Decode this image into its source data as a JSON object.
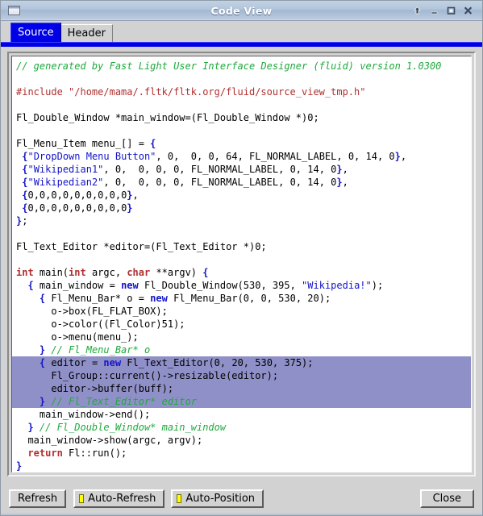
{
  "window": {
    "title": "Code View",
    "icon": "window-icon",
    "controls": [
      {
        "name": "shade-icon",
        "glyph": "up-arrow"
      },
      {
        "name": "minimize-icon",
        "glyph": "minimize"
      },
      {
        "name": "maximize-icon",
        "glyph": "maximize"
      },
      {
        "name": "close-icon",
        "glyph": "close"
      }
    ]
  },
  "tabs": [
    {
      "label": "Source",
      "active": true
    },
    {
      "label": "Header",
      "active": false
    }
  ],
  "code": {
    "caret": "`",
    "lines": [
      {
        "selected": false,
        "tokens": [
          {
            "t": "// generated by Fast Light User Interface Designer (fluid) version 1.0300",
            "c": "c-cmt"
          }
        ]
      },
      {
        "selected": false,
        "tokens": []
      },
      {
        "selected": false,
        "tokens": [
          {
            "t": "#include \"/home/mama/.fltk/fltk.org/fluid/source_view_tmp.h\"",
            "c": "c-pre"
          }
        ]
      },
      {
        "selected": false,
        "tokens": []
      },
      {
        "selected": false,
        "tokens": [
          {
            "t": "Fl_Double_Window *main_window=(Fl_Double_Window *)0;",
            "c": "c-pln"
          }
        ]
      },
      {
        "selected": false,
        "tokens": []
      },
      {
        "selected": false,
        "tokens": [
          {
            "t": "Fl_Menu_Item menu_[] = ",
            "c": "c-pln"
          },
          {
            "t": "{",
            "c": "c-blu"
          }
        ]
      },
      {
        "selected": false,
        "tokens": [
          {
            "t": " ",
            "c": "c-pln"
          },
          {
            "t": "{",
            "c": "c-blu"
          },
          {
            "t": "\"DropDown Menu Button\"",
            "c": "c-str"
          },
          {
            "t": ", 0,  0, 0, 64, FL_NORMAL_LABEL, 0, 14, 0",
            "c": "c-pln"
          },
          {
            "t": "}",
            "c": "c-blu"
          },
          {
            "t": ",",
            "c": "c-pln"
          }
        ]
      },
      {
        "selected": false,
        "tokens": [
          {
            "t": " ",
            "c": "c-pln"
          },
          {
            "t": "{",
            "c": "c-blu"
          },
          {
            "t": "\"Wikipedian1\"",
            "c": "c-str"
          },
          {
            "t": ", 0,  0, 0, 0, FL_NORMAL_LABEL, 0, 14, 0",
            "c": "c-pln"
          },
          {
            "t": "}",
            "c": "c-blu"
          },
          {
            "t": ",",
            "c": "c-pln"
          }
        ]
      },
      {
        "selected": false,
        "tokens": [
          {
            "t": " ",
            "c": "c-pln"
          },
          {
            "t": "{",
            "c": "c-blu"
          },
          {
            "t": "\"Wikipedian2\"",
            "c": "c-str"
          },
          {
            "t": ", 0,  0, 0, 0, FL_NORMAL_LABEL, 0, 14, 0",
            "c": "c-pln"
          },
          {
            "t": "}",
            "c": "c-blu"
          },
          {
            "t": ",",
            "c": "c-pln"
          }
        ]
      },
      {
        "selected": false,
        "tokens": [
          {
            "t": " ",
            "c": "c-pln"
          },
          {
            "t": "{",
            "c": "c-blu"
          },
          {
            "t": "0,0,0,0,0,0,0,0,0",
            "c": "c-pln"
          },
          {
            "t": "}",
            "c": "c-blu"
          },
          {
            "t": ",",
            "c": "c-pln"
          }
        ]
      },
      {
        "selected": false,
        "tokens": [
          {
            "t": " ",
            "c": "c-pln"
          },
          {
            "t": "{",
            "c": "c-blu"
          },
          {
            "t": "0,0,0,0,0,0,0,0,0",
            "c": "c-pln"
          },
          {
            "t": "}",
            "c": "c-blu"
          }
        ]
      },
      {
        "selected": false,
        "tokens": [
          {
            "t": "}",
            "c": "c-blu"
          },
          {
            "t": ";",
            "c": "c-pln"
          }
        ]
      },
      {
        "selected": false,
        "tokens": []
      },
      {
        "selected": false,
        "tokens": [
          {
            "t": "Fl_Text_Editor *editor=(Fl_Text_Editor *)0;",
            "c": "c-pln"
          }
        ]
      },
      {
        "selected": false,
        "tokens": []
      },
      {
        "selected": false,
        "tokens": [
          {
            "t": "int",
            "c": "c-kw"
          },
          {
            "t": " main(",
            "c": "c-pln"
          },
          {
            "t": "int",
            "c": "c-kw"
          },
          {
            "t": " argc, ",
            "c": "c-pln"
          },
          {
            "t": "char",
            "c": "c-kw"
          },
          {
            "t": " **argv) ",
            "c": "c-pln"
          },
          {
            "t": "{",
            "c": "c-blu"
          }
        ]
      },
      {
        "selected": false,
        "tokens": [
          {
            "t": "  ",
            "c": "c-pln"
          },
          {
            "t": "{",
            "c": "c-blu"
          },
          {
            "t": " main_window = ",
            "c": "c-pln"
          },
          {
            "t": "new",
            "c": "c-blu"
          },
          {
            "t": " Fl_Double_Window(530, 395, ",
            "c": "c-pln"
          },
          {
            "t": "\"Wikipedia!\"",
            "c": "c-str"
          },
          {
            "t": ");",
            "c": "c-pln"
          }
        ]
      },
      {
        "selected": false,
        "tokens": [
          {
            "t": "    ",
            "c": "c-pln"
          },
          {
            "t": "{",
            "c": "c-blu"
          },
          {
            "t": " Fl_Menu_Bar* o = ",
            "c": "c-pln"
          },
          {
            "t": "new",
            "c": "c-blu"
          },
          {
            "t": " Fl_Menu_Bar(0, 0, 530, 20);",
            "c": "c-pln"
          }
        ]
      },
      {
        "selected": false,
        "tokens": [
          {
            "t": "      o->box(FL_FLAT_BOX);",
            "c": "c-pln"
          }
        ]
      },
      {
        "selected": false,
        "tokens": [
          {
            "t": "      o->color((Fl_Color)51);",
            "c": "c-pln"
          }
        ]
      },
      {
        "selected": false,
        "tokens": [
          {
            "t": "      o->menu(menu_);",
            "c": "c-pln"
          }
        ]
      },
      {
        "selected": false,
        "tokens": [
          {
            "t": "    ",
            "c": "c-pln"
          },
          {
            "t": "}",
            "c": "c-blu"
          },
          {
            "t": " // Fl_Menu_Bar* o",
            "c": "c-cmt"
          }
        ]
      },
      {
        "selected": true,
        "tokens": [
          {
            "t": "    ",
            "c": "c-pln"
          },
          {
            "t": "{",
            "c": "c-blu"
          },
          {
            "t": " editor = ",
            "c": "c-pln"
          },
          {
            "t": "new",
            "c": "c-blu"
          },
          {
            "t": " Fl_Text_Editor(0, 20, 530, 375);",
            "c": "c-pln"
          }
        ]
      },
      {
        "selected": true,
        "tokens": [
          {
            "t": "      Fl_Group::current()->resizable(editor);",
            "c": "c-pln"
          }
        ]
      },
      {
        "selected": true,
        "tokens": [
          {
            "t": "      editor->buffer(buff);",
            "c": "c-pln"
          }
        ]
      },
      {
        "selected": true,
        "tokens": [
          {
            "t": "    ",
            "c": "c-pln"
          },
          {
            "t": "}",
            "c": "c-blu"
          },
          {
            "t": " // Fl_Text_Editor* editor",
            "c": "c-cmt"
          }
        ]
      },
      {
        "selected": false,
        "tokens": [
          {
            "t": "    main_window->end();",
            "c": "c-pln"
          }
        ]
      },
      {
        "selected": false,
        "tokens": [
          {
            "t": "  ",
            "c": "c-pln"
          },
          {
            "t": "}",
            "c": "c-blu"
          },
          {
            "t": " // Fl_Double_Window* main_window",
            "c": "c-cmt"
          }
        ]
      },
      {
        "selected": false,
        "tokens": [
          {
            "t": "  main_window->show(argc, argv);",
            "c": "c-pln"
          }
        ]
      },
      {
        "selected": false,
        "tokens": [
          {
            "t": "  ",
            "c": "c-pln"
          },
          {
            "t": "return",
            "c": "c-kw"
          },
          {
            "t": " Fl::run();",
            "c": "c-pln"
          }
        ]
      },
      {
        "selected": false,
        "tokens": [
          {
            "t": "}",
            "c": "c-blu"
          }
        ]
      },
      {
        "selected": false,
        "tokens": []
      }
    ]
  },
  "toolbar": {
    "refresh_label": "Refresh",
    "auto_refresh_label": "Auto-Refresh",
    "auto_position_label": "Auto-Position",
    "close_label": "Close",
    "auto_refresh_on": true,
    "auto_position_on": true
  },
  "colors": {
    "selection": "#9090c8",
    "active_tab": "#0000e6",
    "indicator_on": "#ffff00",
    "comment": "#1faa3c",
    "preprocessor": "#b03030",
    "keyword": "#b03030",
    "brace": "#1414c8",
    "string": "#1414c8"
  }
}
